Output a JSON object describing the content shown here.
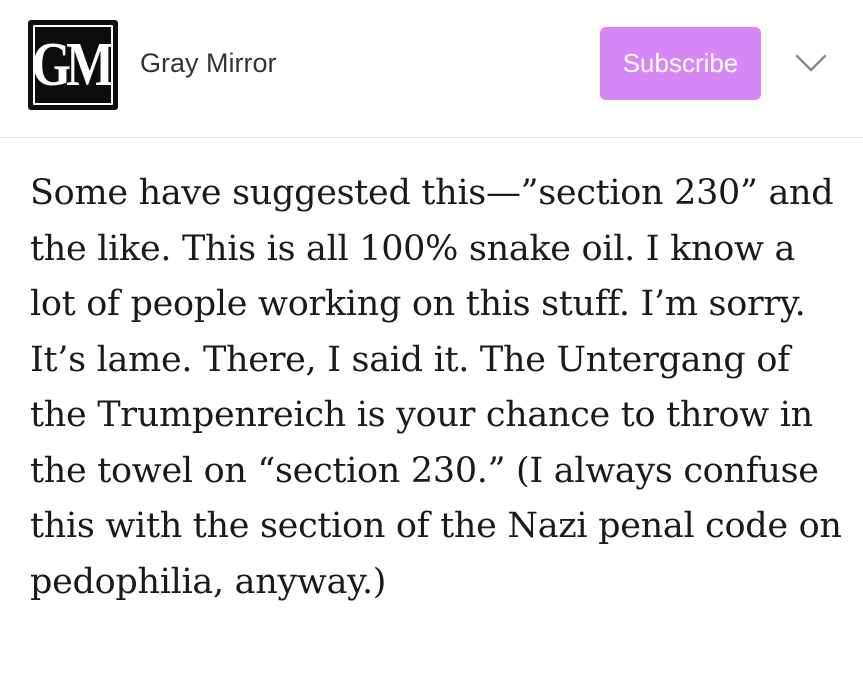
{
  "header": {
    "logo_text": "GM",
    "publication_name": "Gray Mirror",
    "subscribe_label": "Subscribe"
  },
  "article": {
    "paragraph": "Some have suggested this—”section 230” and the like. This is all 100% snake oil. I know a lot of people working on this stuff. I’m sorry. It’s lame. There, I said it. The Untergang of the Trumpenreich is your chance to throw in the towel on “section 230.” (I always confuse this with the section of the Nazi penal code on pedophilia, anyway.)"
  },
  "colors": {
    "subscribe_bg": "#d787f5",
    "logo_bg": "#0d0d0d",
    "text": "#1a1a1a"
  },
  "icons": {
    "menu_toggle": "chevron-down-icon"
  }
}
